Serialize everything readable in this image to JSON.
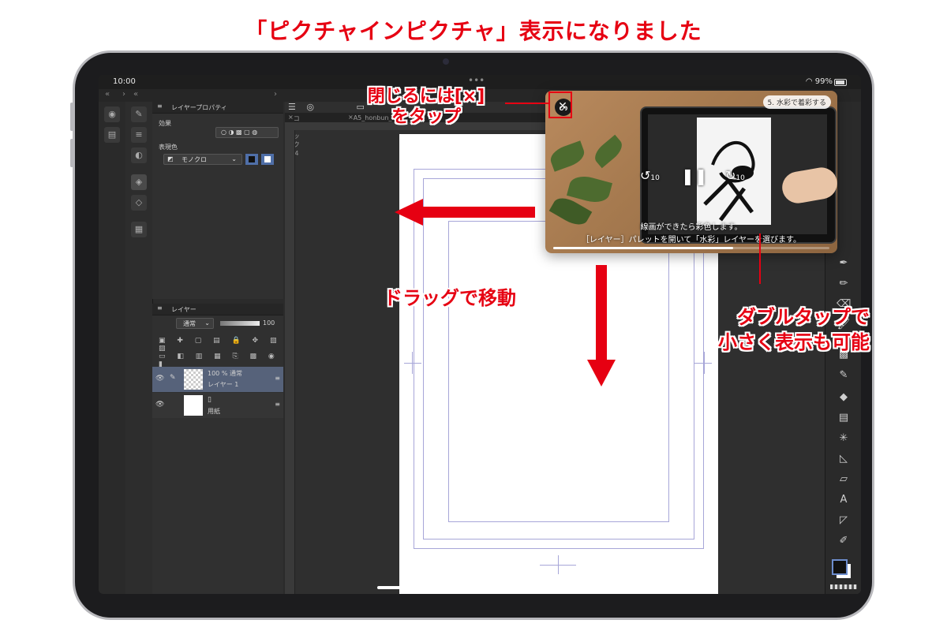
{
  "headline": "「ピクチャインピクチャ」表示になりました",
  "status_bar": {
    "time": "10:00",
    "battery": "99%"
  },
  "tabs": [
    "コミック４",
    "A5_honbun_6",
    "コミック４"
  ],
  "layer_property_panel": {
    "title": "レイヤープロパティ",
    "effect_label": "効果",
    "expression_color_label": "表現色",
    "expression_color_value": "モノクロ"
  },
  "layer_panel": {
    "title": "レイヤー",
    "blend_mode": "通常",
    "opacity": "100",
    "layers": [
      {
        "info": "100 % 通常",
        "name": "レイヤー 1"
      },
      {
        "info": "",
        "name": "用紙"
      }
    ]
  },
  "pip": {
    "badge": "5. 水彩で着彩する",
    "caption_1": "線画ができたら彩色します。",
    "caption_2": "［レイヤー］パレットを開いて「水彩」レイヤーを選びます。",
    "skip_back": "10",
    "skip_forward": "10",
    "progress": 0.65
  },
  "annotations": {
    "close_1": "閉じるには[×]",
    "close_2": "をタップ",
    "drag": "ドラッグで移動",
    "double_tap_1": "ダブルタップで",
    "double_tap_2": "小さく表示も可能"
  },
  "colors": {
    "accent_red": "#e60012",
    "guide_blue": "#a7a6d8"
  },
  "icons": [
    "close-icon",
    "pause-icon",
    "skip-back-icon",
    "skip-forward-icon",
    "wifi-icon",
    "battery-icon",
    "eye-icon",
    "pen-icon",
    "layer-icon"
  ]
}
